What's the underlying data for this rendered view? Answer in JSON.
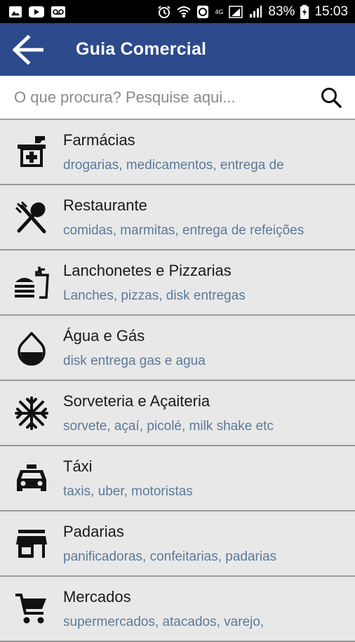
{
  "status_bar": {
    "battery": "83%",
    "time": "15:03",
    "network": "4G"
  },
  "app_bar": {
    "title": "Guia Comercial",
    "background": "#2c4a8c"
  },
  "search": {
    "placeholder": "O que procura? Pesquise aqui..."
  },
  "categories": [
    {
      "title": "Farmácias",
      "subtitle": "drogarias, medicamentos, entrega de",
      "icon": "pharmacy-icon"
    },
    {
      "title": "Restaurante",
      "subtitle": "comidas, marmitas, entrega de refeições",
      "icon": "restaurant-icon"
    },
    {
      "title": "Lanchonetes e Pizzarias",
      "subtitle": "Lanches, pizzas, disk entregas",
      "icon": "fastfood-icon"
    },
    {
      "title": "Água e Gás",
      "subtitle": "disk entrega gas e agua",
      "icon": "water-drop-icon"
    },
    {
      "title": "Sorveteria e Açaiteria",
      "subtitle": "sorvete, açaí, picolé, milk shake etc",
      "icon": "snowflake-icon"
    },
    {
      "title": "Táxi",
      "subtitle": "taxis, uber, motoristas",
      "icon": "taxi-icon"
    },
    {
      "title": "Padarias",
      "subtitle": "panificadoras, confeitarias, padarias",
      "icon": "store-icon"
    },
    {
      "title": "Mercados",
      "subtitle": "supermercados, atacados, varejo,",
      "icon": "shopping-cart-icon"
    }
  ]
}
